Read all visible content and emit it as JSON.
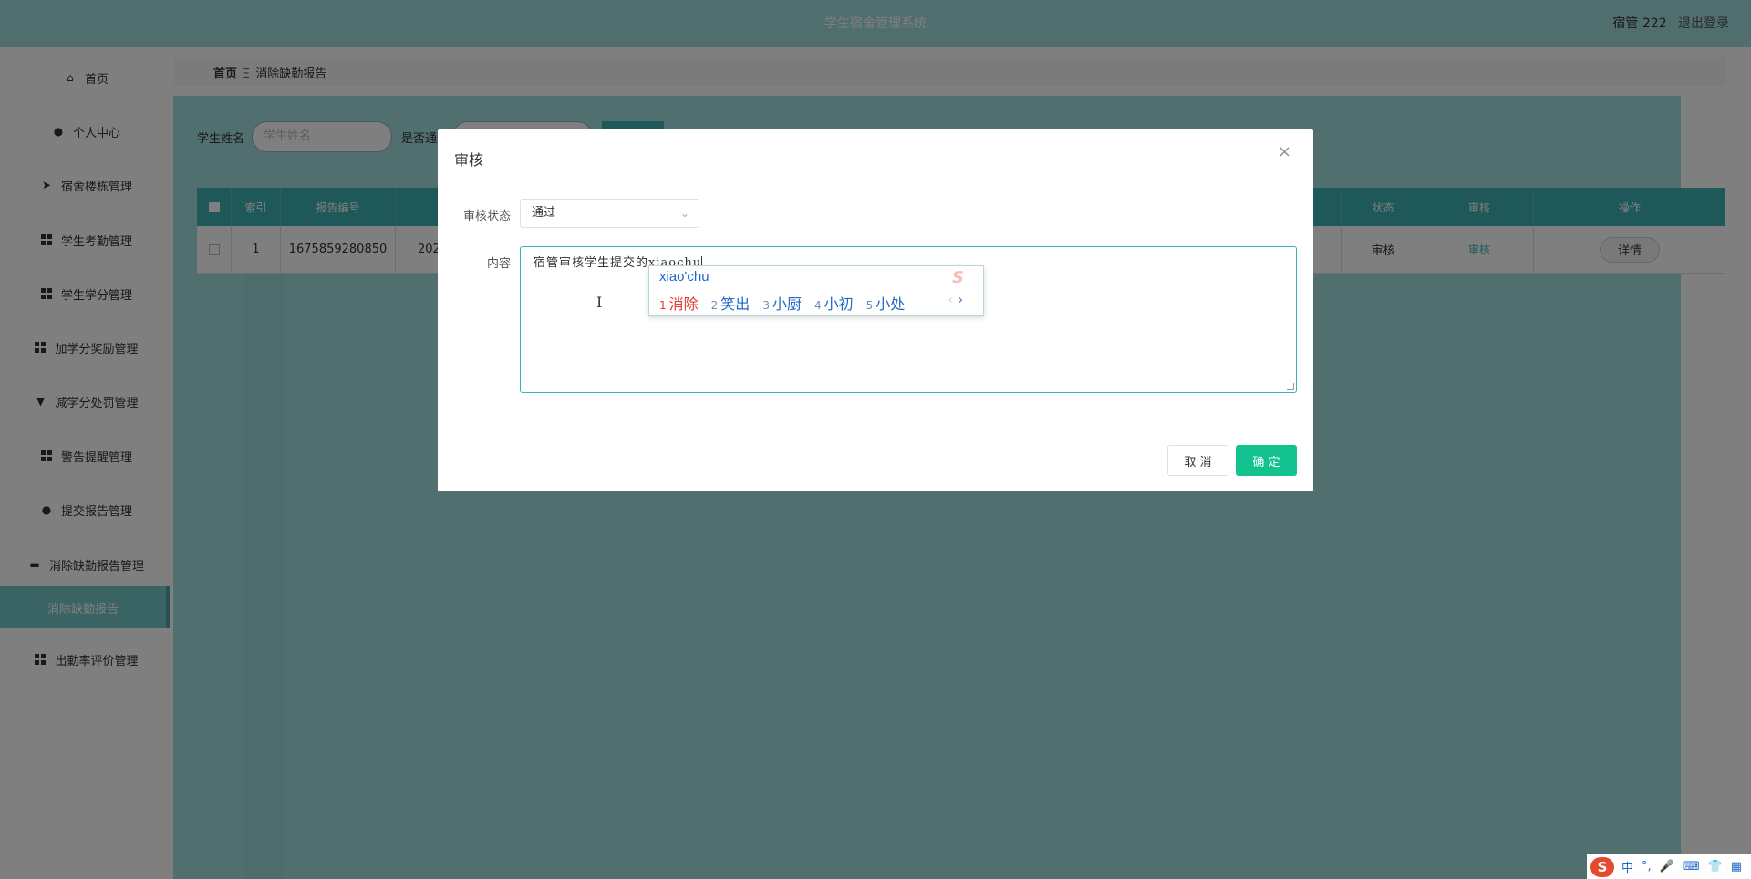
{
  "header": {
    "app_title": "学生宿舍管理系统",
    "user": "宿管 222",
    "logout": "退出登录"
  },
  "sidebar": {
    "items": [
      {
        "label": "首页",
        "icon": "home-icon"
      },
      {
        "label": "个人中心",
        "icon": "user-icon"
      },
      {
        "label": "宿舍楼栋管理",
        "icon": "send-icon"
      },
      {
        "label": "学生考勤管理",
        "icon": "grid-icon"
      },
      {
        "label": "学生学分管理",
        "icon": "grid-icon"
      },
      {
        "label": "加学分奖励管理",
        "icon": "grid-icon"
      },
      {
        "label": "减学分处罚管理",
        "icon": "flag-icon"
      },
      {
        "label": "警告提醒管理",
        "icon": "grid-icon"
      },
      {
        "label": "提交报告管理",
        "icon": "user-icon"
      },
      {
        "label": "消除缺勤报告管理",
        "icon": "chat-icon"
      },
      {
        "label": "消除缺勤报告",
        "icon": ""
      },
      {
        "label": "出勤率评价管理",
        "icon": "grid-icon"
      }
    ]
  },
  "breadcrumb": {
    "home": "首页",
    "separator": "Ξ",
    "current": "消除缺勤报告"
  },
  "search": {
    "name_label": "学生姓名",
    "name_placeholder": "学生姓名",
    "pass_label": "是否通过"
  },
  "table": {
    "headers": [
      "",
      "索引",
      "报告编号",
      "",
      "",
      "",
      "",
      "",
      "",
      "",
      "",
      "状态",
      "审核",
      "操作"
    ],
    "row": {
      "index": "1",
      "report_no": "1675859280850",
      "date_partial": "202",
      "status_partial": "审核",
      "audit_link": "审核",
      "detail": "详情"
    }
  },
  "dialog": {
    "title": "审核",
    "status_label": "审核状态",
    "status_value": "通过",
    "content_label": "内容",
    "content_value": "宿管审核学生提交的xiaochu",
    "cancel": "取 消",
    "confirm": "确 定"
  },
  "ime": {
    "pinyin": "xiao'chu",
    "candidates": [
      {
        "n": "1",
        "text": "消除"
      },
      {
        "n": "2",
        "text": "笑出"
      },
      {
        "n": "3",
        "text": "小厨"
      },
      {
        "n": "4",
        "text": "小初"
      },
      {
        "n": "5",
        "text": "小处"
      }
    ],
    "prev": "‹",
    "next": "›"
  },
  "tray": {
    "lang": "中",
    "punct": "°,",
    "icons": [
      "mic-icon",
      "keyboard-icon",
      "shirt-icon",
      "apps-icon"
    ]
  },
  "colors": {
    "header_bg": "#9fdcdb",
    "table_header_bg": "#3cb1b0",
    "confirm_button": "#13c28f",
    "ime_candidate": "#2267c9",
    "ime_first": "#e23b2f"
  }
}
